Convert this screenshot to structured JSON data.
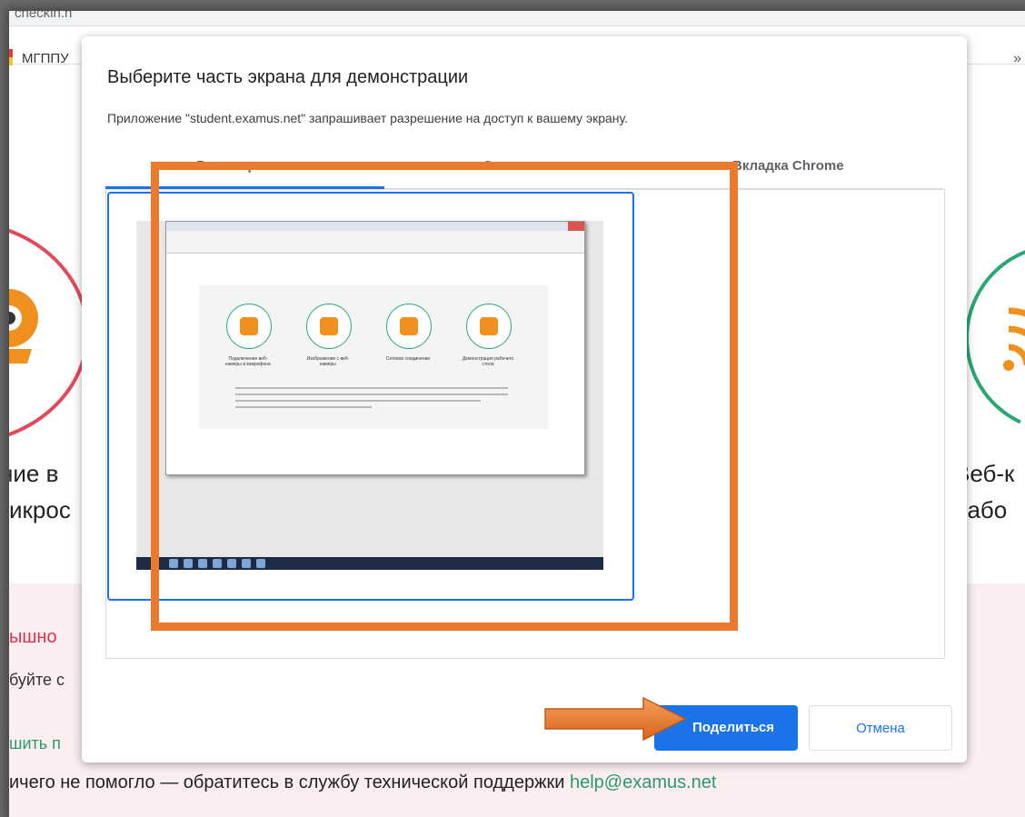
{
  "browser": {
    "url_text": "checkin.h",
    "bookmark_label": "МГППУ",
    "more_label": "»"
  },
  "background": {
    "text_left_1": "ние в",
    "text_left_2": "икрос",
    "text_right_1": "Веб-к",
    "text_right_2": "рабо",
    "error_left": "ышно",
    "try_left": "буйте с",
    "link_left": "шить п",
    "footer_text": "ичего не помогло — обратитесь в службу технической поддержки ",
    "footer_email": "help@examus.net"
  },
  "dialog": {
    "title": "Выберите часть экрана для демонстрации",
    "subtitle": "Приложение \"student.examus.net\" запрашивает разрешение на доступ к вашему экрану.",
    "tabs": [
      {
        "label": "Весь экран"
      },
      {
        "label": "Окно"
      },
      {
        "label": "Вкладка Chrome"
      }
    ],
    "share_button": "Поделиться",
    "cancel_button": "Отмена"
  },
  "thumbnail": {
    "items": [
      {
        "label": "Подключение веб-камеры и микрофона"
      },
      {
        "label": "Изображение с веб-камеры"
      },
      {
        "label": "Сетевое соединение"
      },
      {
        "label": "Демонстрация рабочего стола"
      }
    ]
  },
  "colors": {
    "accent": "#1a73e8",
    "highlight": "#ec7a2c",
    "brand_green": "#2aa874",
    "error_red": "#e0314f"
  }
}
